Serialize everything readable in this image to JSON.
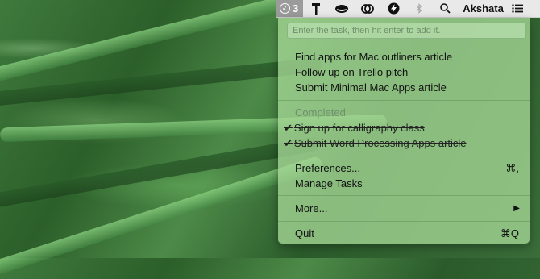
{
  "menubar": {
    "extension_count": "3",
    "icons": [
      "taskplane-check-icon",
      "hammer-icon",
      "eye-icon",
      "link-rings-icon",
      "bolt-icon",
      "bluetooth-icon",
      "search-icon"
    ],
    "user": "Akshata"
  },
  "input": {
    "placeholder": "Enter the task, then hit enter to add it."
  },
  "tasks": [
    "Find apps for Mac outliners article",
    "Follow up on Trello pitch",
    "Submit Minimal Mac Apps article"
  ],
  "completed": {
    "header": "Completed",
    "items": [
      "Sign up for calligraphy class",
      "Submit Word Processing Apps article"
    ],
    "tick": "✔"
  },
  "menu": {
    "preferences": "Preferences...",
    "preferences_shortcut": "⌘,",
    "manage_tasks": "Manage Tasks",
    "more": "More...",
    "more_arrow": "▶",
    "quit": "Quit",
    "quit_shortcut": "⌘Q"
  }
}
